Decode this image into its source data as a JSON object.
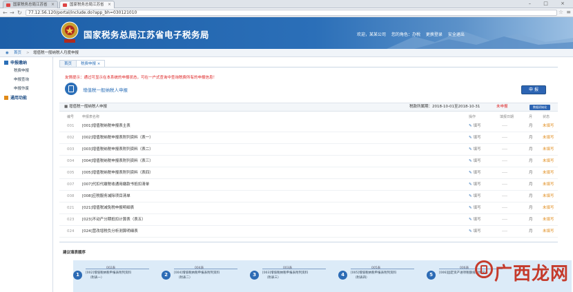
{
  "browser": {
    "tabs": [
      {
        "label": "国家税务总局江苏省"
      },
      {
        "label": "国家税务总局江苏省"
      }
    ],
    "url": "77.12.56.120/portal/include.do?app_bh=030121010",
    "win_controls": "– □ ×"
  },
  "header": {
    "site_title": "国家税务总局江苏省电子税务局",
    "links": [
      "欢迎，某某公司",
      "您的角色：办税",
      "更换登录",
      "安全退出"
    ]
  },
  "breadcrumb": {
    "home": "首页",
    "current": "增值税一般纳税人月度申报"
  },
  "sidebar": {
    "sections": [
      {
        "label": "申报缴纳",
        "items": [
          "税费申报",
          "申报查询",
          "申报作废"
        ]
      },
      {
        "label": "通用功能",
        "items": []
      }
    ]
  },
  "main": {
    "tabs": [
      "首页",
      "税费申报"
    ],
    "warning": "友情提示：通过可显示在本系统的申报状态，可在一户式查询中查询税费所有的申报信息！",
    "form_title": "增值税一般纳税人申报",
    "declare_button": "申 报",
    "section_title": "增值税一般纳税人申报",
    "period_label": "税款所属期：2018-10-01至2018-10-31",
    "status": "未申报",
    "small_button": "数据初始化",
    "columns": [
      "编号",
      "申报表名称",
      "操作",
      "填报日期",
      "月",
      "状态"
    ],
    "rows": [
      {
        "code": "001",
        "name": "[001]增值税纳税申报表主表",
        "op": "填写",
        "date": "----",
        "period": "月",
        "state": "未填写"
      },
      {
        "code": "002",
        "name": "[002]增值税纳税申报表附列资料（表一）",
        "op": "填写",
        "date": "----",
        "period": "月",
        "state": "未填写"
      },
      {
        "code": "003",
        "name": "[003]增值税纳税申报表附列资料（表二）",
        "op": "填写",
        "date": "----",
        "period": "月",
        "state": "未填写"
      },
      {
        "code": "004",
        "name": "[004]增值税纳税申报表附列资料（表三）",
        "op": "填写",
        "date": "----",
        "period": "月",
        "state": "未填写"
      },
      {
        "code": "005",
        "name": "[005]增值税纳税申报表附列资料（表四）",
        "op": "填写",
        "date": "----",
        "period": "月",
        "state": "未填写"
      },
      {
        "code": "007",
        "name": "[007]代扣代缴税收通用缴款书抵扣清单",
        "op": "填写",
        "date": "----",
        "period": "月",
        "state": "未填写"
      },
      {
        "code": "008",
        "name": "[008]应税服务减除项目清单",
        "op": "填写",
        "date": "----",
        "period": "月",
        "state": "未填写"
      },
      {
        "code": "021",
        "name": "[021]增值税减免税申报明细表",
        "op": "填写",
        "date": "----",
        "period": "月",
        "state": "未填写"
      },
      {
        "code": "023",
        "name": "[023]不动产分期抵扣计算表（表五）",
        "op": "填写",
        "date": "----",
        "period": "月",
        "state": "未填写"
      },
      {
        "code": "024",
        "name": "[024]营改增税负分析测算明细表",
        "op": "填写",
        "date": "----",
        "period": "月",
        "state": "未填写"
      }
    ],
    "flow_title": "建议填表顺序",
    "steps": [
      {
        "num": "1",
        "code": "002表",
        "d1": "[002]增值税纳税申报表附列资料",
        "d2": "（附表一）"
      },
      {
        "num": "2",
        "code": "004表",
        "d1": "[004]增值税纳税申报表附列资料",
        "d2": "（附表二）"
      },
      {
        "num": "3",
        "code": "003表",
        "d1": "[003]增值税纳税申报表附列资料",
        "d2": "（附表三）"
      },
      {
        "num": "4",
        "code": "005表",
        "d1": "[005]增值税纳税申报表附列资料",
        "d2": "（附表四）"
      },
      {
        "num": "5",
        "code": "006表",
        "d1": "[006]固定资产进项税额抵扣情况表",
        "d2": ""
      }
    ]
  },
  "watermark": "广西龙网"
}
